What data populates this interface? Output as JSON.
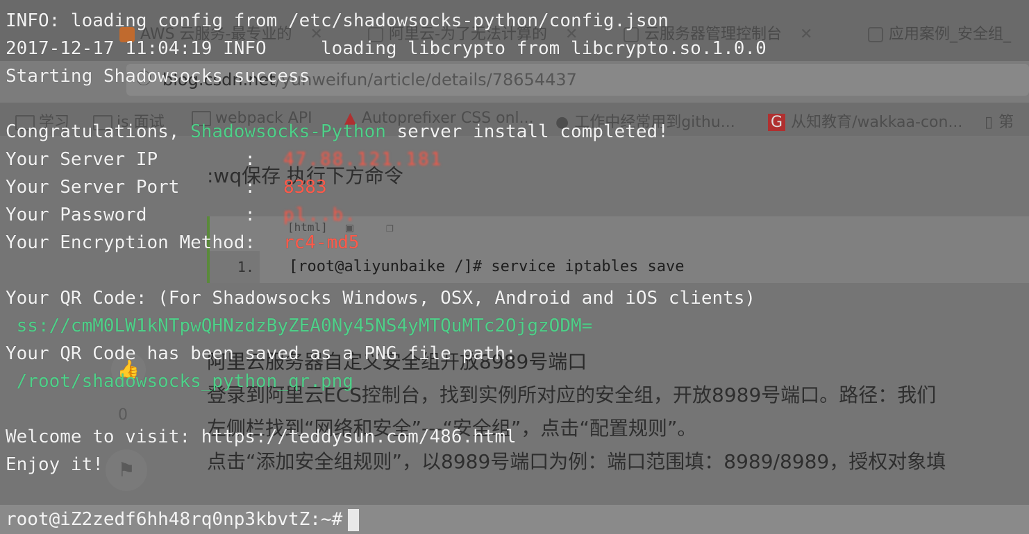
{
  "browser": {
    "tabs": [
      {
        "label": "AWS 云服务-最专业的",
        "icon": "aws-icon",
        "color": "#d26b2a"
      },
      {
        "label": "阿里云-为了无法计算的",
        "icon": "aliyun-icon",
        "color": "#555555"
      },
      {
        "label": "云服务器管理控制台",
        "icon": "aliyun-icon",
        "color": "#555555"
      },
      {
        "label": "应用案例_安全组_",
        "icon": "aliyun-icon",
        "color": "#555555"
      }
    ],
    "address": {
      "host": "blog.csdn.net",
      "path": "/yunweifun/article/details/78654437"
    },
    "bookmarks": [
      {
        "label": "学习",
        "icon": "folder-icon"
      },
      {
        "label": "js 面试",
        "icon": "folder-icon"
      },
      {
        "label": "webpack API",
        "icon": "folder-icon"
      },
      {
        "label": "Autoprefixer CSS onl...",
        "icon": "autoprefixer-icon"
      },
      {
        "label": "工作中经常用到githu...",
        "icon": "github-icon"
      },
      {
        "label": "从知教育/wakkaa-con...",
        "icon": "g-icon"
      },
      {
        "label": "第",
        "icon": "book-icon"
      }
    ]
  },
  "article": {
    "instruction": ":wq保存 执行下方命令",
    "code_tag": "[html]",
    "code_line_number": "1.",
    "code_command": "[root@aliyunbaike /]# service iptables save",
    "heading": "阿里云服务器自定义安全组开放8989号端口",
    "para1": "登录到阿里云ECS控制台，找到实例所对应的安全组，开放8989号端口。路径：我们",
    "para2": "左侧栏找到“网络和安全”---“安全组”，点击“配置规则”。",
    "para3": "点击“添加安全组规则”，以8989号端口为例：端口范围填：8989/8989，授权对象填",
    "like_count": "0"
  },
  "terminal": {
    "line_config": "INFO: loading config from /etc/shadowsocks-python/config.json",
    "line_libcrypto": "2017-12-17 11:04:19 INFO     loading libcrypto from libcrypto.so.1.0.0",
    "line_starting": "Starting Shadowsocks success",
    "congrats_prefix": "Congratulations, ",
    "congrats_name": "Shadowsocks-Python",
    "congrats_suffix": " server install completed!",
    "server_ip_label": "Your Server IP        :",
    "server_ip_value": "47.88.121.181",
    "server_port_label": "Your Server Port      :",
    "server_port_value": "8383",
    "password_label": "Your Password         :",
    "password_value": "pl..b.",
    "method_label": "Your Encryption Method:",
    "method_value": "rc4-md5",
    "qr_intro": "Your QR Code: (For Shadowsocks Windows, OSX, Android and iOS clients)",
    "qr_uri": " ss://cmM0LW1kNTpwQHNzdzByZEA0Ny45NS4yMTQuMTc2OjgzODM=",
    "qr_saved": "Your QR Code has been saved as a PNG file path:",
    "qr_path": " /root/shadowsocks_python_qr.png",
    "welcome": "Welcome to visit: https://teddysun.com/486.html",
    "enjoy": "Enjoy it!",
    "prompt": "root@iZ2zedf6hh48rq0np3kbvtZ:~#"
  },
  "colors": {
    "green": "#4fd089",
    "red": "#ff5a4a",
    "text": "#f2f2f2"
  }
}
